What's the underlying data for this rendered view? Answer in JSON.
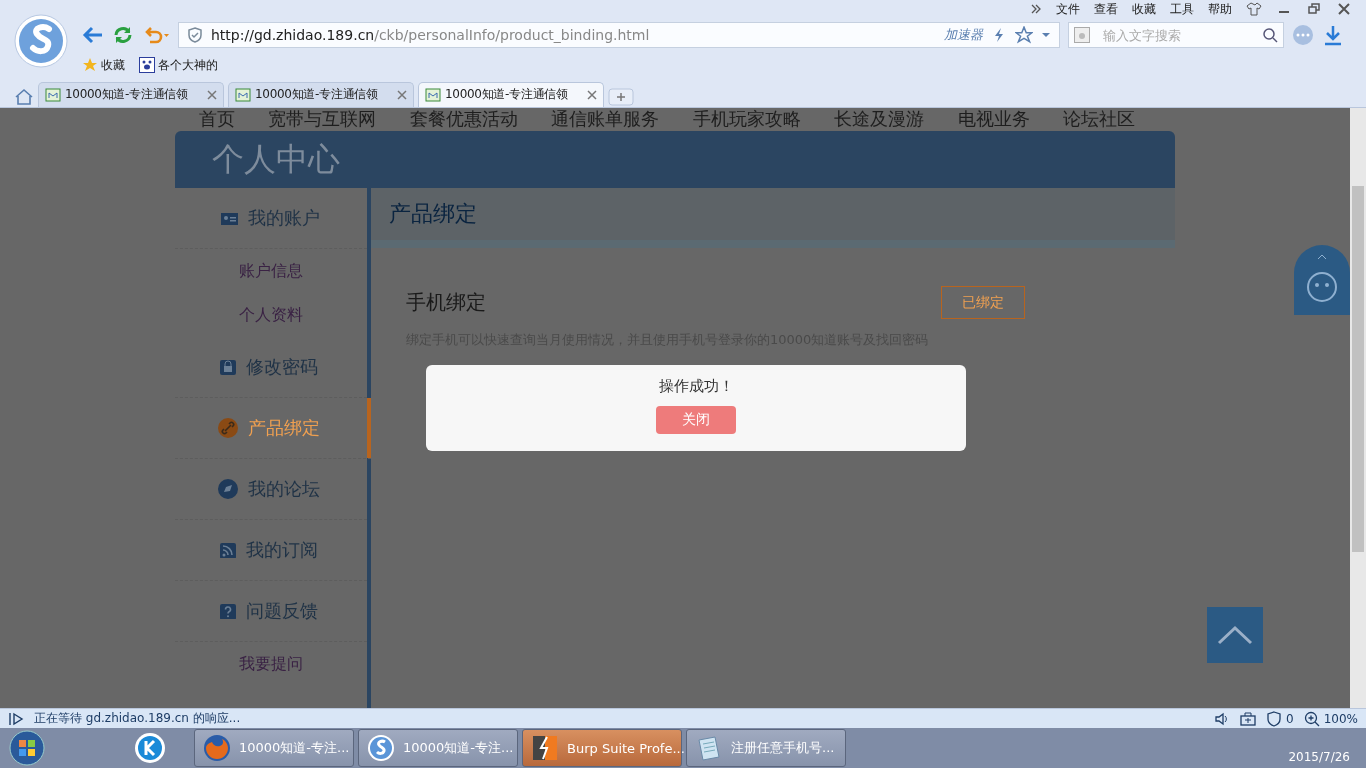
{
  "browser": {
    "menu": [
      "文件",
      "查看",
      "收藏",
      "工具",
      "帮助"
    ],
    "address": {
      "host": "http://gd.zhidao.189.cn",
      "path": "/ckb/personalInfo/product_binding.html"
    },
    "accelerator": "加速器",
    "search": {
      "placeholder": "输入文字搜索"
    },
    "bookmarks": [
      {
        "label": "收藏"
      },
      {
        "label": "各个大神的"
      }
    ],
    "tabs": [
      {
        "label": "10000知道-专注通信领",
        "selected": false
      },
      {
        "label": "10000知道-专注通信领",
        "selected": false
      },
      {
        "label": "10000知道-专注通信领",
        "selected": true
      }
    ]
  },
  "page": {
    "nav": [
      "首页",
      "宽带与互联网",
      "套餐优惠活动",
      "通信账单服务",
      "手机玩家攻略",
      "长途及漫游",
      "电视业务",
      "论坛社区"
    ],
    "header_title": "个人中心",
    "sidebar": [
      {
        "label": "我的账户",
        "kind": "section",
        "selected": false
      },
      {
        "label": "账户信息",
        "kind": "sub",
        "selected": false
      },
      {
        "label": "个人资料",
        "kind": "sub",
        "selected": false
      },
      {
        "label": "修改密码",
        "kind": "section",
        "selected": false
      },
      {
        "label": "产品绑定",
        "kind": "section",
        "selected": true
      },
      {
        "label": "我的论坛",
        "kind": "section",
        "selected": false
      },
      {
        "label": "我的订阅",
        "kind": "section",
        "selected": false
      },
      {
        "label": "问题反馈",
        "kind": "section",
        "selected": false
      },
      {
        "label": "我要提问",
        "kind": "sub",
        "selected": false
      }
    ],
    "section_title": "产品绑定",
    "binding": {
      "title": "手机绑定",
      "status": "已绑定",
      "description": "绑定手机可以快速查询当月使用情况，并且使用手机号登录你的10000知道账号及找回密码"
    },
    "modal": {
      "message": "操作成功！",
      "button": "关闭"
    }
  },
  "status_bar": {
    "text": "正在等待 gd.zhidao.189.cn 的响应...",
    "ad_count": "0",
    "zoom": "100%"
  },
  "taskbar": {
    "items": [
      {
        "label": "10000知道-专注...",
        "kind": "firefox",
        "active": false
      },
      {
        "label": "10000知道-专注...",
        "kind": "sogou",
        "active": false
      },
      {
        "label": "Burp Suite Profe...",
        "kind": "burp",
        "active": true
      },
      {
        "label": "注册任意手机号...",
        "kind": "notepad",
        "active": false
      }
    ],
    "date": "2015/7/26"
  }
}
